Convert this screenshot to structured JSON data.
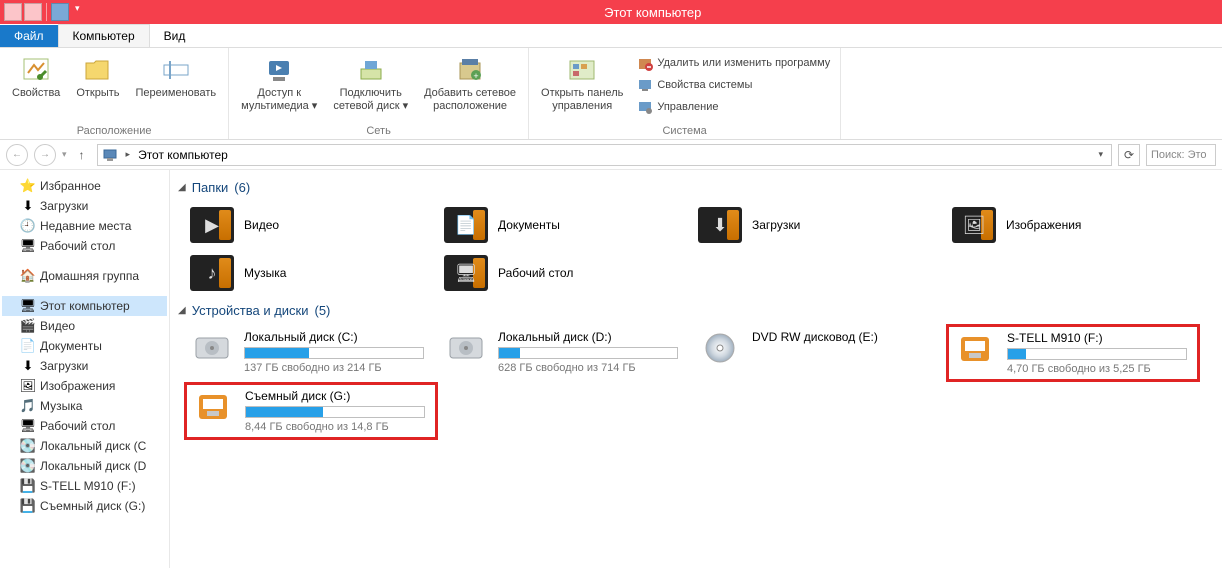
{
  "titlebar": {
    "title": "Этот компьютер"
  },
  "tabs": {
    "file": "Файл",
    "computer": "Компьютер",
    "view": "Вид"
  },
  "ribbon": {
    "location": {
      "group": "Расположение",
      "properties": "Свойства",
      "open": "Открыть",
      "rename": "Переименовать"
    },
    "network": {
      "group": "Сеть",
      "media_access_l1": "Доступ к",
      "media_access_l2": "мультимедиа",
      "map_drive_l1": "Подключить",
      "map_drive_l2": "сетевой диск",
      "add_loc_l1": "Добавить сетевое",
      "add_loc_l2": "расположение"
    },
    "system": {
      "group": "Система",
      "control_panel_l1": "Открыть панель",
      "control_panel_l2": "управления",
      "uninstall": "Удалить или изменить программу",
      "properties": "Свойства системы",
      "manage": "Управление"
    }
  },
  "address": {
    "location": "Этот компьютер"
  },
  "search": {
    "placeholder": "Поиск: Это"
  },
  "sidebar": {
    "favorites": {
      "header": "Избранное",
      "items": [
        {
          "icon": "download",
          "label": "Загрузки"
        },
        {
          "icon": "recent",
          "label": "Недавние места"
        },
        {
          "icon": "desktop",
          "label": "Рабочий стол"
        }
      ]
    },
    "homegroup": {
      "header": "Домашняя группа"
    },
    "thispc": {
      "header": "Этот компьютер",
      "items": [
        {
          "icon": "video",
          "label": "Видео"
        },
        {
          "icon": "docs",
          "label": "Документы"
        },
        {
          "icon": "download",
          "label": "Загрузки"
        },
        {
          "icon": "pictures",
          "label": "Изображения"
        },
        {
          "icon": "music",
          "label": "Музыка"
        },
        {
          "icon": "desktop",
          "label": "Рабочий стол"
        },
        {
          "icon": "hdd",
          "label": "Локальный диск (C"
        },
        {
          "icon": "hdd",
          "label": "Локальный диск (D"
        },
        {
          "icon": "usb",
          "label": "S-TELL M910 (F:)"
        },
        {
          "icon": "usb",
          "label": "Съемный диск (G:)"
        }
      ]
    }
  },
  "content": {
    "folders": {
      "title": "Папки",
      "count": "(6)",
      "items": [
        {
          "glyph": "▶",
          "label": "Видео"
        },
        {
          "glyph": "📄",
          "label": "Документы"
        },
        {
          "glyph": "⬇",
          "label": "Загрузки"
        },
        {
          "glyph": "🖼",
          "label": "Изображения"
        },
        {
          "glyph": "♪",
          "label": "Музыка"
        },
        {
          "glyph": "🖥",
          "label": "Рабочий стол"
        }
      ]
    },
    "drives": {
      "title": "Устройства и диски",
      "count": "(5)",
      "items": [
        {
          "type": "hdd",
          "name": "Локальный диск (C:)",
          "free": "137 ГБ свободно из 214 ГБ",
          "pct": 36,
          "highlighted": false
        },
        {
          "type": "hdd",
          "name": "Локальный диск (D:)",
          "free": "628 ГБ свободно из 714 ГБ",
          "pct": 12,
          "highlighted": false
        },
        {
          "type": "dvd",
          "name": "DVD RW дисковод (E:)",
          "free": "",
          "pct": null,
          "highlighted": false
        },
        {
          "type": "usb",
          "name": "S-TELL M910 (F:)",
          "free": "4,70 ГБ свободно из 5,25 ГБ",
          "pct": 10,
          "highlighted": true
        },
        {
          "type": "usb",
          "name": "Съемный диск (G:)",
          "free": "8,44 ГБ свободно из 14,8 ГБ",
          "pct": 43,
          "highlighted": true
        }
      ]
    }
  }
}
